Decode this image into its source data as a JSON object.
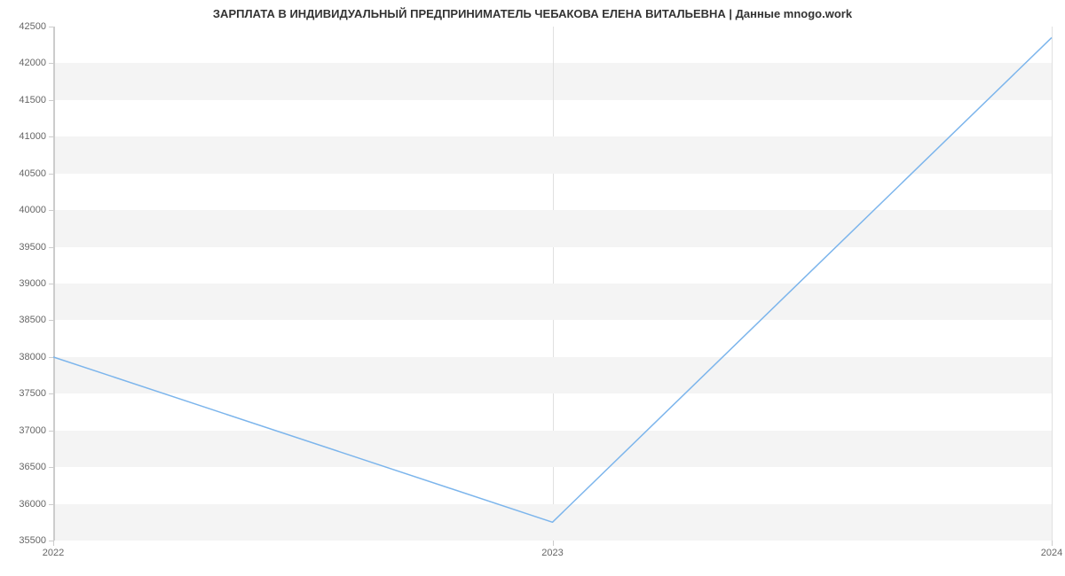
{
  "chart_data": {
    "type": "line",
    "title": "ЗАРПЛАТА В ИНДИВИДУАЛЬНЫЙ ПРЕДПРИНИМАТЕЛЬ ЧЕБАКОВА ЕЛЕНА ВИТАЛЬЕВНА | Данные mnogo.work",
    "x": [
      2022,
      2023,
      2024
    ],
    "values": [
      38000,
      35750,
      42350
    ],
    "x_ticks": [
      2022,
      2023,
      2024
    ],
    "y_ticks": [
      35500,
      36000,
      36500,
      37000,
      37500,
      38000,
      38500,
      39000,
      39500,
      40000,
      40500,
      41000,
      41500,
      42000,
      42500
    ],
    "xlabel": "",
    "ylabel": "",
    "xlim": [
      2022,
      2024
    ],
    "ylim": [
      35500,
      42500
    ],
    "line_color": "#7cb5ec"
  }
}
